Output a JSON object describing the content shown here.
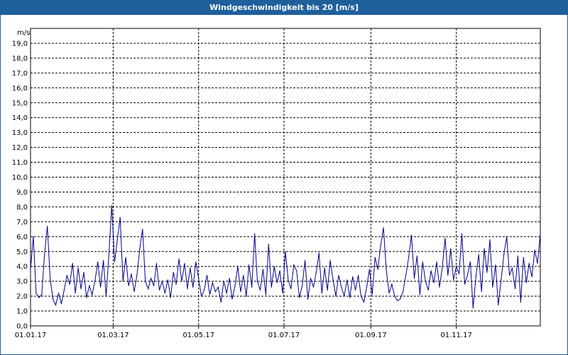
{
  "window": {
    "title": "Windgeschwindigkeit bis 20 [m/s]"
  },
  "chart_data": {
    "type": "line",
    "title": "Windgeschwindigkeit bis 20 [m/s]",
    "ylabel": "m/s",
    "xlabel": "",
    "ylim": [
      0,
      20
    ],
    "xlim": [
      "2017-01-01",
      "2017-12-31"
    ],
    "grid": true,
    "line_color": "#00008b",
    "x_ticks": [
      "01.01.17",
      "01.03.17",
      "01.05.17",
      "01.07.17",
      "01.09.17",
      "01.11.17"
    ],
    "y_ticks": [
      "0,0",
      "1,0",
      "2,0",
      "3,0",
      "4,0",
      "5,0",
      "6,0",
      "7,0",
      "8,0",
      "9,0",
      "10,0",
      "11,0",
      "12,0",
      "13,0",
      "14,0",
      "15,0",
      "16,0",
      "17,0",
      "18,0",
      "19,0"
    ],
    "series": [
      {
        "x": [
          "2017-01-01",
          "2017-01-03",
          "2017-01-05",
          "2017-01-07",
          "2017-01-09",
          "2017-01-11",
          "2017-01-13",
          "2017-01-15",
          "2017-01-17",
          "2017-01-19",
          "2017-01-21",
          "2017-01-23",
          "2017-01-25",
          "2017-01-27",
          "2017-01-29",
          "2017-01-31",
          "2017-02-02",
          "2017-02-04",
          "2017-02-06",
          "2017-02-08",
          "2017-02-10",
          "2017-02-12",
          "2017-02-14",
          "2017-02-16",
          "2017-02-18",
          "2017-02-20",
          "2017-02-22",
          "2017-02-24",
          "2017-02-26",
          "2017-02-28",
          "2017-03-02",
          "2017-03-04",
          "2017-03-06",
          "2017-03-08",
          "2017-03-10",
          "2017-03-12",
          "2017-03-14",
          "2017-03-16",
          "2017-03-18",
          "2017-03-20",
          "2017-03-22",
          "2017-03-24",
          "2017-03-26",
          "2017-03-28",
          "2017-03-30",
          "2017-04-01",
          "2017-04-03",
          "2017-04-05",
          "2017-04-07",
          "2017-04-09",
          "2017-04-11",
          "2017-04-13",
          "2017-04-15",
          "2017-04-17",
          "2017-04-19",
          "2017-04-21",
          "2017-04-23",
          "2017-04-25",
          "2017-04-27",
          "2017-04-29",
          "2017-05-01",
          "2017-05-03",
          "2017-05-05",
          "2017-05-07",
          "2017-05-09",
          "2017-05-11",
          "2017-05-13",
          "2017-05-15",
          "2017-05-17",
          "2017-05-19",
          "2017-05-21",
          "2017-05-23",
          "2017-05-25",
          "2017-05-27",
          "2017-05-29",
          "2017-05-31",
          "2017-06-02",
          "2017-06-04",
          "2017-06-06",
          "2017-06-08",
          "2017-06-10",
          "2017-06-12",
          "2017-06-14",
          "2017-06-16",
          "2017-06-18",
          "2017-06-20",
          "2017-06-22",
          "2017-06-24",
          "2017-06-26",
          "2017-06-28",
          "2017-06-30",
          "2017-07-02",
          "2017-07-04",
          "2017-07-06",
          "2017-07-08",
          "2017-07-10",
          "2017-07-12",
          "2017-07-14",
          "2017-07-16",
          "2017-07-18",
          "2017-07-20",
          "2017-07-22",
          "2017-07-24",
          "2017-07-26",
          "2017-07-28",
          "2017-07-30",
          "2017-08-01",
          "2017-08-03",
          "2017-08-05",
          "2017-08-07",
          "2017-08-09",
          "2017-08-11",
          "2017-08-13",
          "2017-08-15",
          "2017-08-17",
          "2017-08-19",
          "2017-08-21",
          "2017-08-23",
          "2017-08-25",
          "2017-08-27",
          "2017-08-29",
          "2017-08-31",
          "2017-09-02",
          "2017-09-04",
          "2017-09-06",
          "2017-09-08",
          "2017-09-10",
          "2017-09-12",
          "2017-09-14",
          "2017-09-16",
          "2017-09-18",
          "2017-09-20",
          "2017-09-22",
          "2017-09-24",
          "2017-09-26",
          "2017-09-28",
          "2017-09-30",
          "2017-10-02",
          "2017-10-04",
          "2017-10-06",
          "2017-10-08",
          "2017-10-10",
          "2017-10-12",
          "2017-10-14",
          "2017-10-16",
          "2017-10-18",
          "2017-10-20",
          "2017-10-22",
          "2017-10-24",
          "2017-10-26",
          "2017-10-28",
          "2017-10-30",
          "2017-11-01",
          "2017-11-03",
          "2017-11-05",
          "2017-11-07",
          "2017-11-09",
          "2017-11-11",
          "2017-11-13",
          "2017-11-15",
          "2017-11-17",
          "2017-11-19",
          "2017-11-21",
          "2017-11-23",
          "2017-11-25",
          "2017-11-27",
          "2017-11-29",
          "2017-12-01",
          "2017-12-03",
          "2017-12-05",
          "2017-12-07",
          "2017-12-09",
          "2017-12-11",
          "2017-12-13",
          "2017-12-15",
          "2017-12-17",
          "2017-12-19",
          "2017-12-21",
          "2017-12-23",
          "2017-12-25",
          "2017-12-27",
          "2017-12-29",
          "2017-12-31"
        ],
        "y": [
          3.8,
          6.0,
          2.2,
          1.9,
          2.1,
          4.8,
          6.7,
          3.2,
          1.8,
          1.4,
          2.2,
          1.5,
          2.4,
          3.4,
          2.8,
          4.2,
          2.2,
          3.9,
          2.5,
          3.6,
          1.9,
          2.7,
          2.1,
          3.0,
          4.3,
          2.6,
          4.4,
          2.0,
          4.9,
          8.1,
          4.3,
          5.8,
          7.3,
          3.0,
          4.6,
          2.7,
          3.5,
          2.3,
          3.4,
          5.2,
          6.5,
          3.0,
          2.5,
          3.2,
          2.7,
          4.2,
          2.4,
          3.0,
          2.2,
          3.1,
          1.9,
          3.6,
          2.8,
          4.5,
          3.0,
          4.2,
          2.5,
          3.9,
          2.6,
          4.3,
          3.2,
          2.0,
          2.4,
          3.4,
          2.1,
          2.9,
          2.3,
          2.6,
          1.6,
          3.0,
          2.2,
          3.2,
          1.8,
          2.7,
          4.0,
          2.3,
          3.4,
          2.0,
          4.1,
          2.6,
          6.2,
          3.0,
          2.4,
          3.8,
          2.1,
          5.5,
          2.6,
          4.0,
          2.9,
          3.7,
          2.2,
          5.0,
          3.1,
          2.5,
          4.1,
          3.7,
          1.9,
          2.7,
          4.4,
          1.8,
          3.2,
          2.6,
          3.6,
          4.9,
          2.2,
          3.9,
          2.4,
          4.4,
          3.1,
          2.0,
          3.4,
          2.6,
          2.0,
          3.1,
          1.9,
          3.3,
          2.4,
          3.4,
          2.0,
          1.6,
          2.6,
          3.8,
          2.1,
          4.6,
          3.8,
          5.4,
          6.6,
          3.8,
          2.2,
          2.8,
          2.0,
          1.7,
          1.8,
          2.3,
          3.4,
          4.6,
          6.1,
          3.2,
          4.7,
          2.1,
          4.3,
          3.0,
          2.4,
          3.7,
          2.9,
          4.3,
          2.6,
          3.9,
          5.9,
          3.4,
          5.2,
          3.1,
          4.0,
          3.5,
          6.2,
          2.8,
          3.4,
          4.3,
          1.2,
          3.3,
          4.8,
          2.3,
          5.2,
          3.6,
          5.8,
          2.6,
          4.1,
          1.4,
          3.1,
          4.8,
          6.0,
          3.4,
          3.9,
          2.5,
          4.7,
          1.6,
          4.6,
          2.9,
          4.2,
          3.3,
          5.1,
          4.2,
          6.2
        ]
      }
    ]
  }
}
